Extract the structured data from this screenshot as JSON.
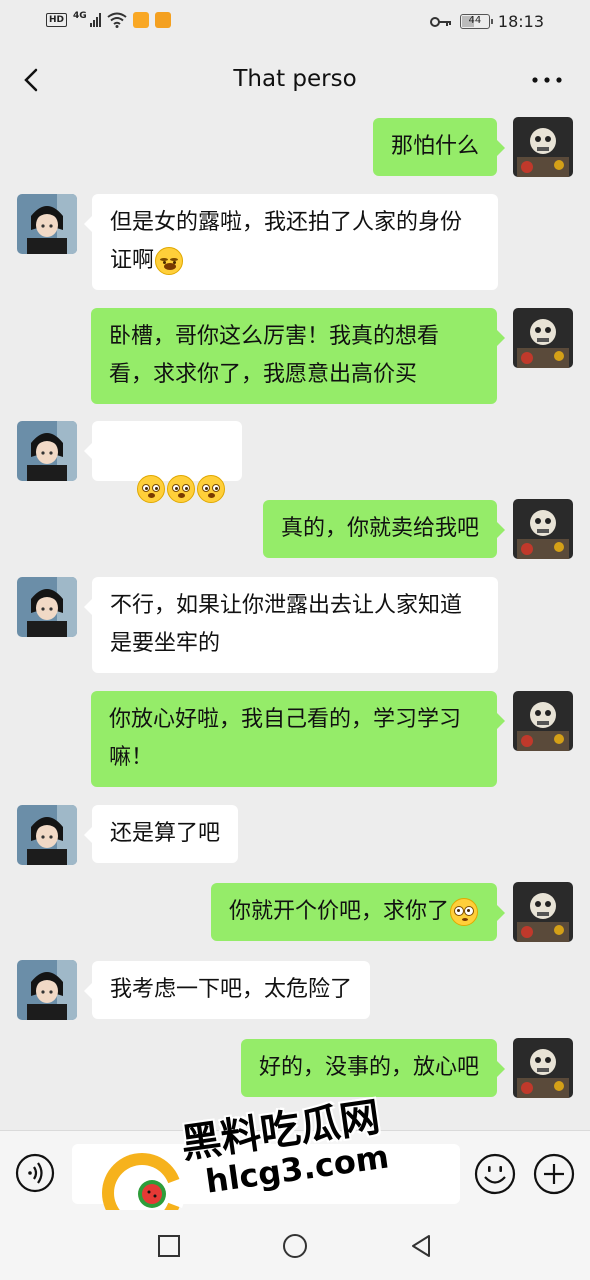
{
  "status_bar": {
    "network_badge": "HD",
    "network_type": "4G",
    "battery": "44",
    "time": "18:13"
  },
  "header": {
    "title": "That perso"
  },
  "messages": [
    {
      "side": "out",
      "text": "那怕什么"
    },
    {
      "side": "in",
      "text": "但是女的露啦，我还拍了人家的身份证啊",
      "emoji": "face-with-tears-of-joy"
    },
    {
      "side": "out",
      "text": "卧槽，哥你这么厉害！我真的想看看，求求你了，我愿意出高价买"
    },
    {
      "side": "in",
      "text": "",
      "emoji_count": 3,
      "emoji": "flushed-face"
    },
    {
      "side": "out",
      "text": "真的，你就卖给我吧"
    },
    {
      "side": "in",
      "text": "不行，如果让你泄露出去让人家知道是要坐牢的"
    },
    {
      "side": "out",
      "text": "你放心好啦，我自己看的，学习学习嘛！"
    },
    {
      "side": "in",
      "text": "还是算了吧"
    },
    {
      "side": "out",
      "text": "你就开个价吧，求你了",
      "emoji": "pleading-face"
    },
    {
      "side": "in",
      "text": "我考虑一下吧，太危险了"
    },
    {
      "side": "out",
      "text": "好的，没事的，放心吧"
    }
  ],
  "watermark": {
    "name": "黑料吃瓜网",
    "url": "hlcg3.com"
  },
  "colors": {
    "outgoing_bubble": "#95ec69",
    "incoming_bubble": "#ffffff",
    "background": "#ededed"
  }
}
